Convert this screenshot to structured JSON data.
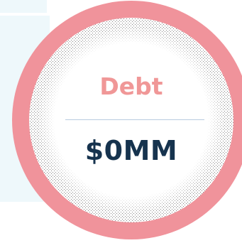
{
  "metric": {
    "label": "Debt",
    "value": "$0MM"
  },
  "colors": {
    "ring": "#f0939b",
    "label": "#f09797",
    "value": "#16334e",
    "divider": "#b8cbdf",
    "panel": "#eef8fb",
    "stipple": "#4a4a4a"
  }
}
